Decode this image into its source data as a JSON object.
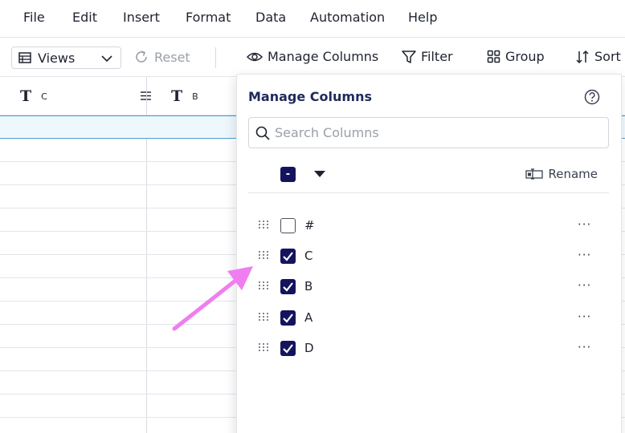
{
  "menu": [
    "File",
    "Edit",
    "Insert",
    "Format",
    "Data",
    "Automation",
    "Help"
  ],
  "toolbar": {
    "views_label": "Views",
    "reset_label": "Reset",
    "manage_columns_label": "Manage Columns",
    "filter_label": "Filter",
    "group_label": "Group",
    "sort_label": "Sort"
  },
  "grid": {
    "columns": [
      {
        "type_icon": "T",
        "name": "C"
      },
      {
        "type_icon": "T",
        "name": "B"
      }
    ]
  },
  "panel": {
    "title": "Manage Columns",
    "search_placeholder": "Search Columns",
    "bulk_symbol": "-",
    "rename_label": "Rename",
    "more_symbol": "···",
    "columns": [
      {
        "label": "#",
        "checked": false
      },
      {
        "label": "C",
        "checked": true
      },
      {
        "label": "B",
        "checked": true
      },
      {
        "label": "A",
        "checked": true
      },
      {
        "label": "D",
        "checked": true
      }
    ]
  },
  "colors": {
    "accent": "#14145e",
    "selection_border": "#4a9fd8",
    "annotation_arrow": "#f07ef0"
  },
  "icons": [
    "table-icon",
    "chevron-down-icon",
    "reset-icon",
    "eye-icon",
    "filter-icon",
    "group-icon",
    "sort-icon",
    "text-type-icon",
    "hamburger-icon",
    "help-icon",
    "search-icon",
    "caret-down-icon",
    "rename-icon",
    "drag-handle-icon",
    "check-icon",
    "more-icon",
    "arrow-annotation-icon"
  ]
}
